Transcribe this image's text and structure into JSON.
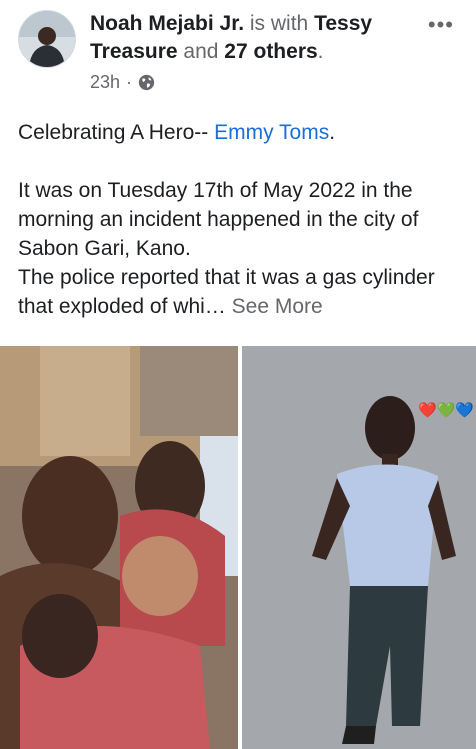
{
  "post": {
    "author": "Noah Mejabi Jr.",
    "with_text": "is with",
    "tagged": "Tessy Treasure",
    "and_text": "and",
    "others": "27 others",
    "period": ".",
    "time": "23h",
    "dot": "·",
    "privacy_icon": "globe-icon",
    "more_icon": "•••"
  },
  "text": {
    "line1_prefix": "Celebrating A Hero-- ",
    "mention": "Emmy Toms",
    "line1_suffix": ".",
    "para2": "It was on Tuesday 17th of May 2022  in the morning an incident happened in the city of Sabon Gari, Kano.",
    "para3": " The police reported that it was a gas cylinder that exploded of whi…",
    "see_more": " See More"
  },
  "photos": {
    "right_hearts": "❤️💚💙"
  },
  "colors": {
    "link": "#1a6ed8",
    "muted": "#65676b",
    "text": "#1c1e21"
  }
}
